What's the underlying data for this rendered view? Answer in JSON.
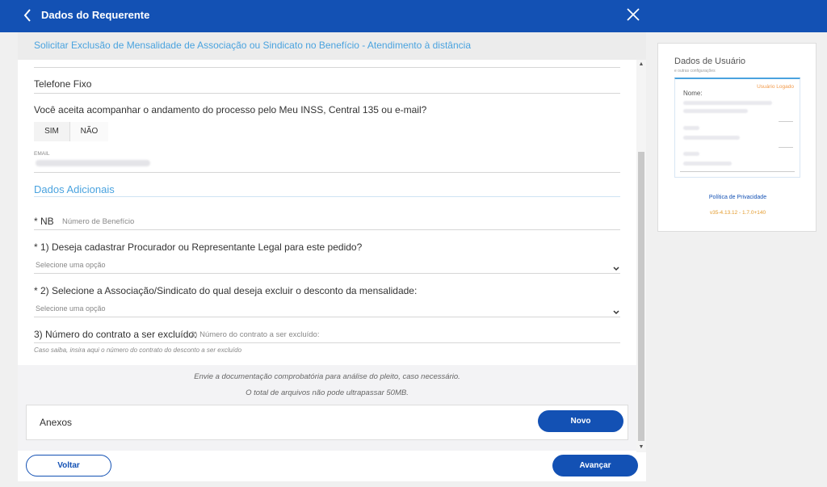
{
  "header": {
    "title": "Dados do Requerente"
  },
  "service": {
    "title": "Solicitar Exclusão de Mensalidade de Associação ou Sindicato no Benefício - Atendimento à distância"
  },
  "form": {
    "phone_label": "Telefone Fixo",
    "consent_question": "Você aceita acompanhar o andamento do processo pelo Meu INSS, Central 135 ou e-mail?",
    "consent_yes": "SIM",
    "consent_no": "NÃO",
    "email_label": "EMAIL",
    "section_title": "Dados Adicionais",
    "nb_label": "* NB",
    "nb_placeholder": "Número de Benefício",
    "q1_label": "* 1) Deseja cadastrar Procurador ou Representante Legal para este pedido?",
    "q1_select": "Selecione uma opção",
    "q2_label": "* 2) Selecione a Associação/Sindicato do qual deseja excluir o desconto da mensalidade:",
    "q2_select": "Selecione uma opção",
    "q3_label": "3) Número do contrato a ser excluído:",
    "q3_placeholder": "3) Número do contrato a ser excluído:",
    "q3_hint": "Caso saiba, insira aqui o número do contrato do desconto a ser excluído"
  },
  "attachments": {
    "note1": "Envie a documentação comprobatória para análise do pleito, caso necessário.",
    "note2": "O total de arquivos não pode ultrapassar 50MB.",
    "label": "Anexos",
    "new_button": "Novo"
  },
  "footer": {
    "back_button": "Voltar",
    "next_button": "Avançar"
  },
  "sidebar": {
    "title": "Dados de Usuário",
    "subtitle": "e outras configurações",
    "logged": "Usuário Logado",
    "name_label": "Nome:",
    "privacy": "Política de Privacidade",
    "version": "v35-4.13.12 - 1.7.0+140"
  },
  "colors": {
    "primary": "#1351b4",
    "accent": "#4aa3df",
    "warning": "#f29a4b"
  }
}
